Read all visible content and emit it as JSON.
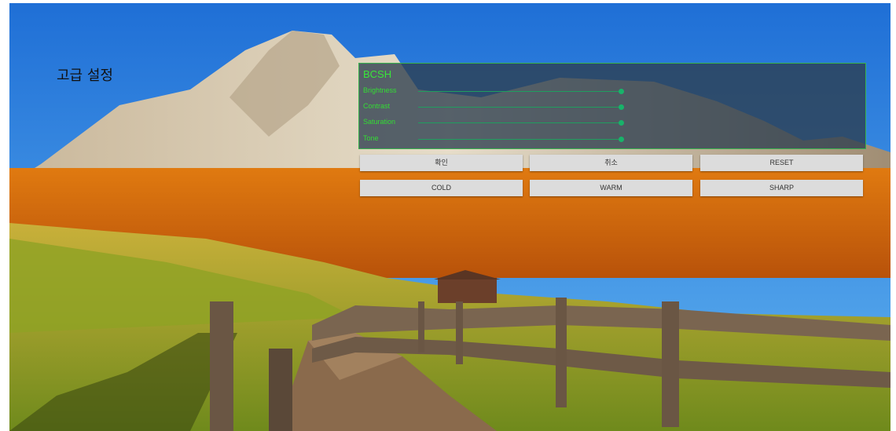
{
  "page": {
    "title": "고급 설정"
  },
  "bcsh": {
    "title": "BCSH",
    "sliders": [
      {
        "label": "Brightness",
        "value": 1.0
      },
      {
        "label": "Contrast",
        "value": 1.0
      },
      {
        "label": "Saturation",
        "value": 1.0
      },
      {
        "label": "Tone",
        "value": 1.0
      }
    ]
  },
  "buttons": {
    "confirm": "확인",
    "cancel": "취소",
    "reset": "RESET",
    "cold": "COLD",
    "warm": "WARM",
    "sharp": "SHARP"
  },
  "colors": {
    "panel_border": "#37b24d",
    "label_green": "#33dd33",
    "slider": "#18b36a",
    "button_bg": "#dcdcdc"
  }
}
